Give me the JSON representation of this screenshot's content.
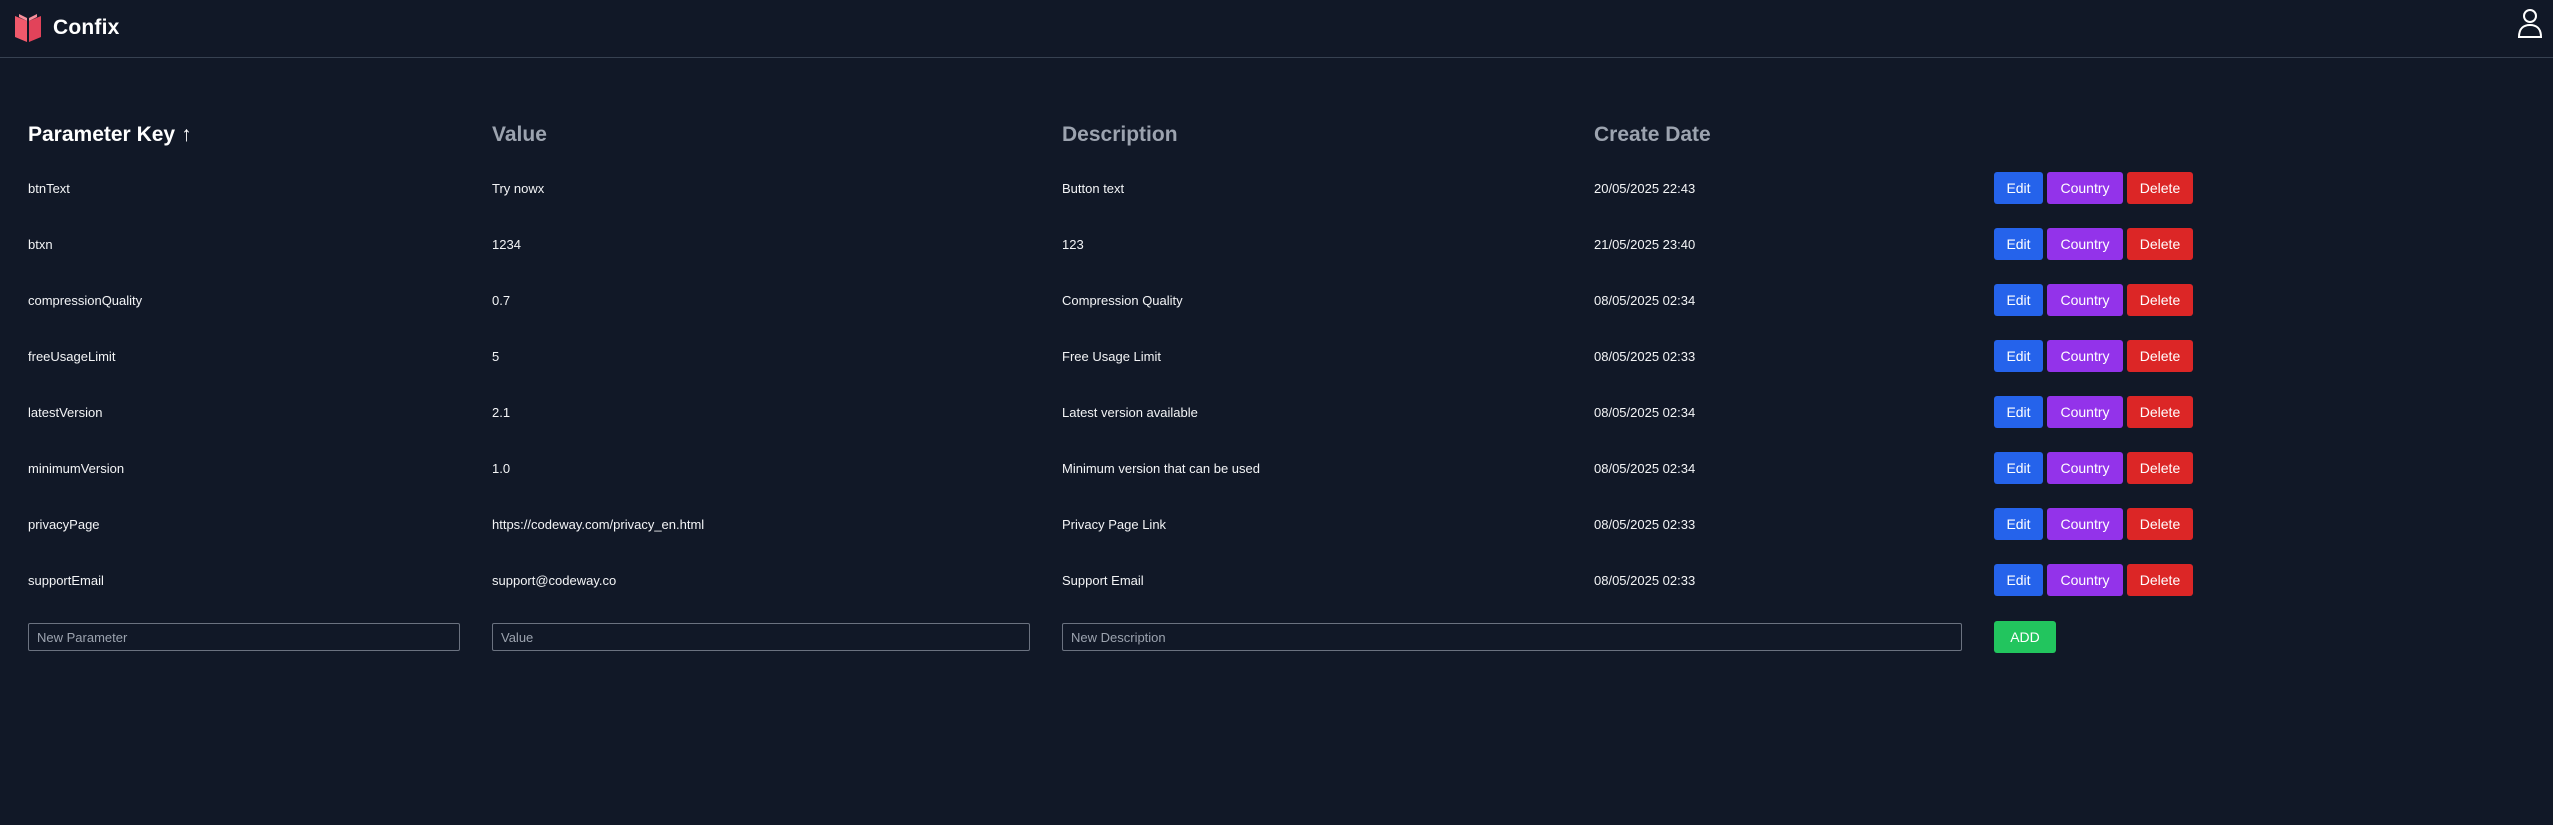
{
  "app": {
    "name": "Confix"
  },
  "icons": {
    "logo": "book-logo-icon",
    "user": "user-icon",
    "sort": "arrow-up-icon"
  },
  "colors": {
    "background": "#111827",
    "edit": "#2563eb",
    "country": "#9333ea",
    "delete": "#dc2626",
    "add": "#22c55e",
    "logo": "#f0596b"
  },
  "table": {
    "headers": {
      "key": "Parameter Key",
      "sort_indicator": "↑",
      "value": "Value",
      "description": "Description",
      "create_date": "Create Date"
    },
    "actions": {
      "edit": "Edit",
      "country": "Country",
      "delete": "Delete"
    },
    "rows": [
      {
        "key": "btnText",
        "value": "Try nowx",
        "description": "Button text",
        "date": "20/05/2025 22:43"
      },
      {
        "key": "btxn",
        "value": "1234",
        "description": "123",
        "date": "21/05/2025 23:40"
      },
      {
        "key": "compressionQuality",
        "value": "0.7",
        "description": "Compression Quality",
        "date": "08/05/2025 02:34"
      },
      {
        "key": "freeUsageLimit",
        "value": "5",
        "description": "Free Usage Limit",
        "date": "08/05/2025 02:33"
      },
      {
        "key": "latestVersion",
        "value": "2.1",
        "description": "Latest version available",
        "date": "08/05/2025 02:34"
      },
      {
        "key": "minimumVersion",
        "value": "1.0",
        "description": "Minimum version that can be used",
        "date": "08/05/2025 02:34"
      },
      {
        "key": "privacyPage",
        "value": "https://codeway.com/privacy_en.html",
        "description": "Privacy Page Link",
        "date": "08/05/2025 02:33"
      },
      {
        "key": "supportEmail",
        "value": "support@codeway.co",
        "description": "Support Email",
        "date": "08/05/2025 02:33"
      }
    ]
  },
  "add_form": {
    "key_placeholder": "New Parameter",
    "key_value": "",
    "value_placeholder": "Value",
    "value_value": "",
    "description_placeholder": "New Description",
    "description_value": "",
    "add_label": "ADD"
  }
}
